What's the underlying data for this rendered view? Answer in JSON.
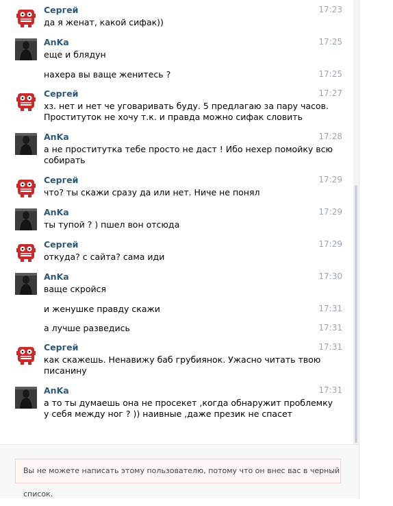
{
  "users": {
    "sergey": {
      "name": "Сергей",
      "avatar_icon": "meat-boy-avatar-icon",
      "color": "#c62b2b"
    },
    "anka": {
      "name": "AnKa",
      "avatar_icon": "dark-photo-avatar-icon",
      "color": "#2b2b2b"
    }
  },
  "messages": [
    {
      "author": "Сергей",
      "time": "17:23",
      "lines": [
        "да я женат, какой сифак))"
      ]
    },
    {
      "author": "AnKa",
      "time": "17:25",
      "lines": [
        "еще и блядун"
      ]
    },
    {
      "author": "",
      "time": "17:25",
      "lines": [
        "нахера вы ваще женитесь ?"
      ]
    },
    {
      "author": "Сергей",
      "time": "17:27",
      "lines": [
        "хз. нет и нет че уговаривать буду. 5 предлагаю за пару часов.",
        "Проституток не хочу т.к. и правда можно сифак словить"
      ]
    },
    {
      "author": "AnKa",
      "time": "17:28",
      "lines": [
        "а не проститутка тебе просто не даст ! Ибо нехер помойку всю",
        "собирать"
      ]
    },
    {
      "author": "Сергей",
      "time": "17:29",
      "lines": [
        "что? ты скажи сразу да или нет. Ниче не понял"
      ]
    },
    {
      "author": "AnKa",
      "time": "17:29",
      "lines": [
        "ты тупой ? ) пшел вон отсюда"
      ]
    },
    {
      "author": "Сергей",
      "time": "17:29",
      "lines": [
        "откуда? с сайта? сама иди"
      ]
    },
    {
      "author": "AnKa",
      "time": "17:30",
      "lines": [
        "ваще скройся"
      ]
    },
    {
      "author": "",
      "time": "17:31",
      "lines": [
        "и женушке правду скажи"
      ]
    },
    {
      "author": "",
      "time": "17:31",
      "lines": [
        "а лучше разведись"
      ]
    },
    {
      "author": "Сергей",
      "time": "17:31",
      "lines": [
        "как скажешь. Ненавижу баб грубиянок. Ужасно читать твою",
        "писанину"
      ]
    },
    {
      "author": "AnKa",
      "time": "17:31",
      "lines": [
        "а то ты думаешь она не просекет ,когда обнаружит проблемку",
        "у себя между ног ? )) наивные ,даже презик не спасет"
      ]
    }
  ],
  "notice": "Вы не можете написать этому пользователю, потому что он внес вас в черный список."
}
